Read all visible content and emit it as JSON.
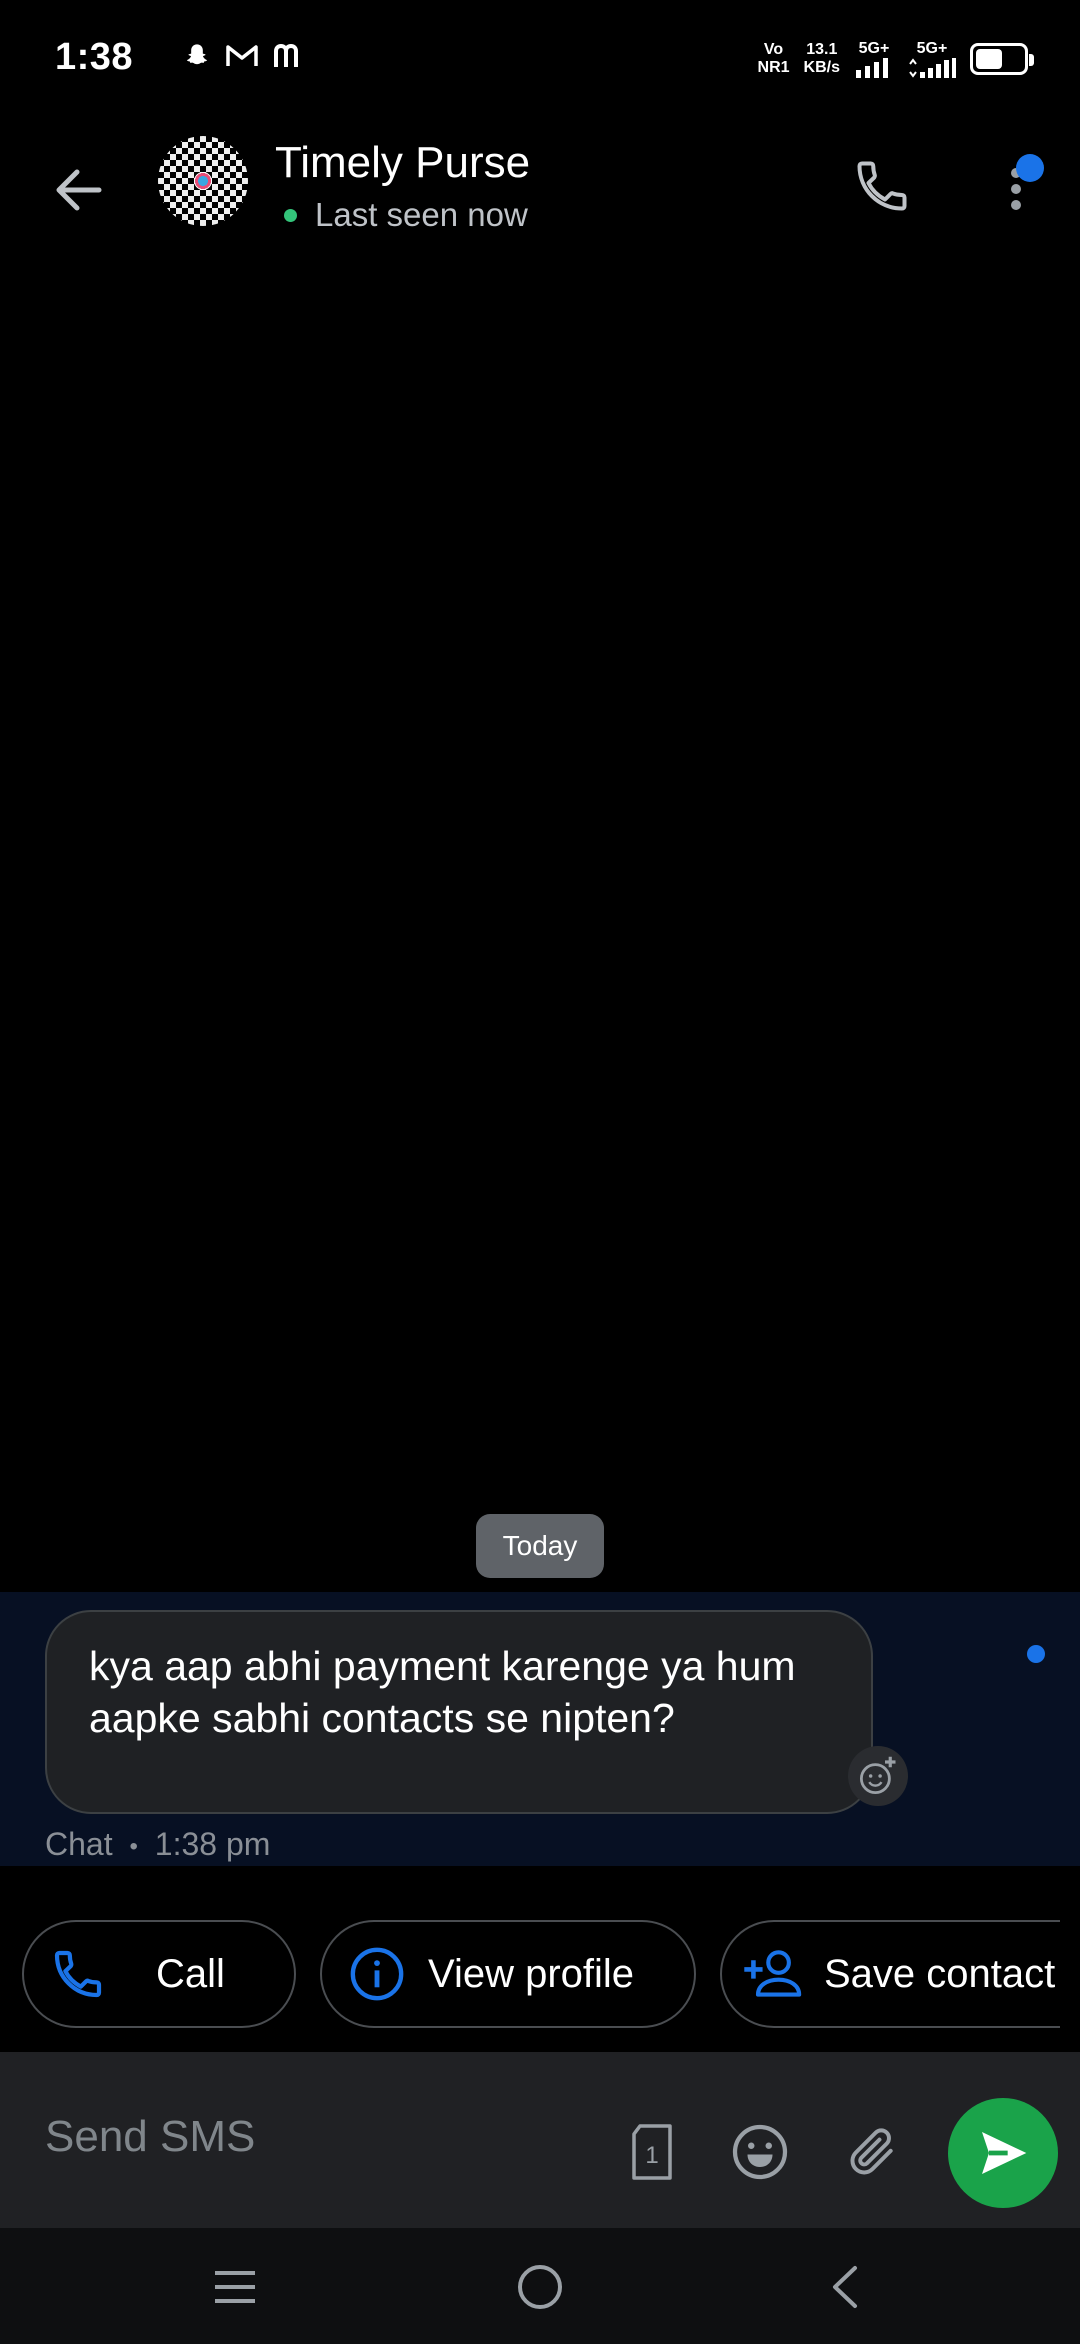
{
  "status_bar": {
    "time": "1:38",
    "notification_icons": [
      "snapchat-icon",
      "gmail-icon",
      "messenger-icon"
    ],
    "volte_top": "Vo",
    "volte_bottom": "NR1",
    "speed_value": "13.1",
    "speed_unit": "KB/s",
    "sim1_label": "5G+",
    "sim2_label": "5G+",
    "battery_level": 0.5
  },
  "header": {
    "contact_name": "Timely Purse",
    "status_text": "Last seen now",
    "online_color": "#33c47a",
    "badge_color": "#1a73e8"
  },
  "chat": {
    "date_divider": "Today",
    "message_text": "kya aap abhi payment karenge ya hum aapke sabhi contacts se nipten?",
    "message_type": "Chat",
    "message_separator": "•",
    "message_time": "1:38 pm"
  },
  "quick_actions": {
    "call_label": "Call",
    "view_profile_label": "View profile",
    "save_contact_label": "Save contact"
  },
  "compose": {
    "placeholder": "Send SMS",
    "sim_number": "1",
    "send_color": "#1aa34a"
  },
  "accent_color": "#1a73e8"
}
